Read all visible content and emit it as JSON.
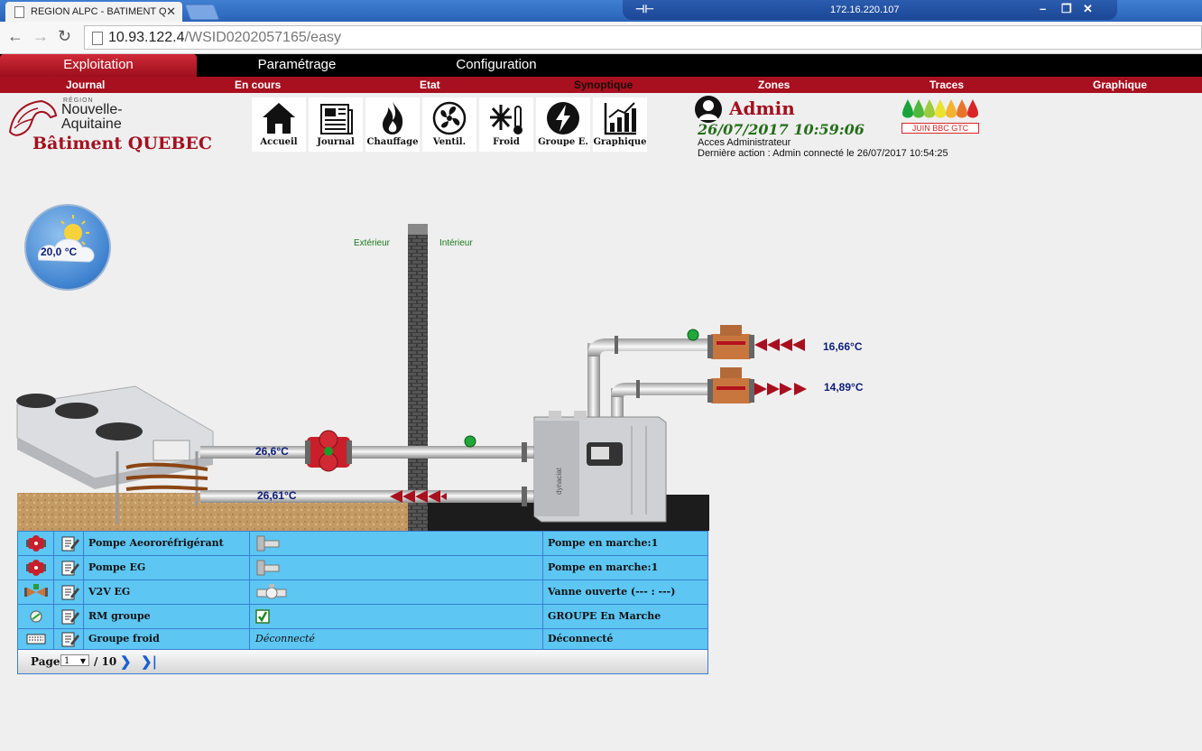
{
  "browser": {
    "tab_title": "REGION ALPC - BATIMENT Q",
    "remote_ip": "172.16.220.107",
    "url_host": "10.93.122.4",
    "url_path": "/WSID0202057165/easy"
  },
  "menu": {
    "main": [
      "Exploitation",
      "Paramétrage",
      "Configuration"
    ],
    "sub": [
      "Journal",
      "En cours",
      "Etat",
      "Synoptique",
      "Zones",
      "Traces",
      "Graphique"
    ]
  },
  "logo": {
    "region_small": "RÉGION",
    "region_line1": "Nouvelle-",
    "region_line2": "Aquitaine",
    "building": "Bâtiment QUEBEC"
  },
  "toolbar": [
    "Accueil",
    "Journal",
    "Chauffage",
    "Ventil.",
    "Froid",
    "Groupe E.",
    "Graphique"
  ],
  "user": {
    "name": "Admin",
    "datetime": "26/07/2017 10:59:06",
    "access": "Acces Administrateur",
    "last_action": "Dernière action : Admin connecté le 26/07/2017 10:54:25"
  },
  "energy_label": {
    "text": "JUIN BBC GTC",
    "colors": [
      "#19a33b",
      "#4fb83a",
      "#9ccb3b",
      "#e9e233",
      "#f4b233",
      "#e8742c",
      "#d9252a"
    ]
  },
  "synoptic": {
    "outdoor_temp": "20,0 °C",
    "label_exterior": "Extérieur",
    "label_interior": "Intérieur",
    "temp_supply_hot": "26,6°C",
    "temp_return_hot": "26,61°C",
    "temp_cold_return": "16,66°C",
    "temp_cold_supply": "14,89°C"
  },
  "equipment_table": {
    "rows": [
      {
        "icon": "pump-icon",
        "name": "Pompe Aeororéfrigérant",
        "value": "",
        "value_icon": "pump-state-icon",
        "status": "Pompe en marche:1"
      },
      {
        "icon": "pump-icon",
        "name": "Pompe EG",
        "value": "",
        "value_icon": "pump-state-icon",
        "status": "Pompe en marche:1"
      },
      {
        "icon": "valve-icon",
        "name": "V2V EG",
        "value": "",
        "value_icon": "valve-state-icon",
        "status": "Vanne ouverte (--- : ---)"
      },
      {
        "icon": "relay-icon",
        "name": "RM groupe",
        "value": "",
        "value_icon": "checkbox-checked-icon",
        "status": "GROUPE En Marche"
      },
      {
        "icon": "keyboard-icon",
        "name": "Groupe froid",
        "value": "Déconnecté",
        "value_icon": "",
        "status": "Déconnecté"
      }
    ],
    "pager": {
      "label": "Page",
      "current": "1",
      "total": "/ 10"
    }
  }
}
